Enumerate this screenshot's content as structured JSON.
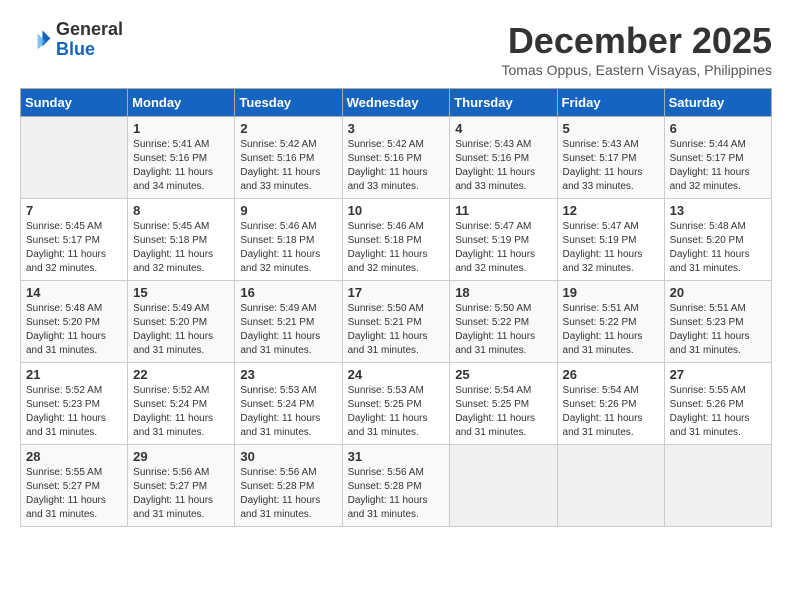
{
  "header": {
    "logo_line1": "General",
    "logo_line2": "Blue",
    "month_year": "December 2025",
    "location": "Tomas Oppus, Eastern Visayas, Philippines"
  },
  "calendar": {
    "days_of_week": [
      "Sunday",
      "Monday",
      "Tuesday",
      "Wednesday",
      "Thursday",
      "Friday",
      "Saturday"
    ],
    "weeks": [
      [
        {
          "day": "",
          "sunrise": "",
          "sunset": "",
          "daylight": ""
        },
        {
          "day": "1",
          "sunrise": "Sunrise: 5:41 AM",
          "sunset": "Sunset: 5:16 PM",
          "daylight": "Daylight: 11 hours and 34 minutes."
        },
        {
          "day": "2",
          "sunrise": "Sunrise: 5:42 AM",
          "sunset": "Sunset: 5:16 PM",
          "daylight": "Daylight: 11 hours and 33 minutes."
        },
        {
          "day": "3",
          "sunrise": "Sunrise: 5:42 AM",
          "sunset": "Sunset: 5:16 PM",
          "daylight": "Daylight: 11 hours and 33 minutes."
        },
        {
          "day": "4",
          "sunrise": "Sunrise: 5:43 AM",
          "sunset": "Sunset: 5:16 PM",
          "daylight": "Daylight: 11 hours and 33 minutes."
        },
        {
          "day": "5",
          "sunrise": "Sunrise: 5:43 AM",
          "sunset": "Sunset: 5:17 PM",
          "daylight": "Daylight: 11 hours and 33 minutes."
        },
        {
          "day": "6",
          "sunrise": "Sunrise: 5:44 AM",
          "sunset": "Sunset: 5:17 PM",
          "daylight": "Daylight: 11 hours and 32 minutes."
        }
      ],
      [
        {
          "day": "7",
          "sunrise": "Sunrise: 5:45 AM",
          "sunset": "Sunset: 5:17 PM",
          "daylight": "Daylight: 11 hours and 32 minutes."
        },
        {
          "day": "8",
          "sunrise": "Sunrise: 5:45 AM",
          "sunset": "Sunset: 5:18 PM",
          "daylight": "Daylight: 11 hours and 32 minutes."
        },
        {
          "day": "9",
          "sunrise": "Sunrise: 5:46 AM",
          "sunset": "Sunset: 5:18 PM",
          "daylight": "Daylight: 11 hours and 32 minutes."
        },
        {
          "day": "10",
          "sunrise": "Sunrise: 5:46 AM",
          "sunset": "Sunset: 5:18 PM",
          "daylight": "Daylight: 11 hours and 32 minutes."
        },
        {
          "day": "11",
          "sunrise": "Sunrise: 5:47 AM",
          "sunset": "Sunset: 5:19 PM",
          "daylight": "Daylight: 11 hours and 32 minutes."
        },
        {
          "day": "12",
          "sunrise": "Sunrise: 5:47 AM",
          "sunset": "Sunset: 5:19 PM",
          "daylight": "Daylight: 11 hours and 32 minutes."
        },
        {
          "day": "13",
          "sunrise": "Sunrise: 5:48 AM",
          "sunset": "Sunset: 5:20 PM",
          "daylight": "Daylight: 11 hours and 31 minutes."
        }
      ],
      [
        {
          "day": "14",
          "sunrise": "Sunrise: 5:48 AM",
          "sunset": "Sunset: 5:20 PM",
          "daylight": "Daylight: 11 hours and 31 minutes."
        },
        {
          "day": "15",
          "sunrise": "Sunrise: 5:49 AM",
          "sunset": "Sunset: 5:20 PM",
          "daylight": "Daylight: 11 hours and 31 minutes."
        },
        {
          "day": "16",
          "sunrise": "Sunrise: 5:49 AM",
          "sunset": "Sunset: 5:21 PM",
          "daylight": "Daylight: 11 hours and 31 minutes."
        },
        {
          "day": "17",
          "sunrise": "Sunrise: 5:50 AM",
          "sunset": "Sunset: 5:21 PM",
          "daylight": "Daylight: 11 hours and 31 minutes."
        },
        {
          "day": "18",
          "sunrise": "Sunrise: 5:50 AM",
          "sunset": "Sunset: 5:22 PM",
          "daylight": "Daylight: 11 hours and 31 minutes."
        },
        {
          "day": "19",
          "sunrise": "Sunrise: 5:51 AM",
          "sunset": "Sunset: 5:22 PM",
          "daylight": "Daylight: 11 hours and 31 minutes."
        },
        {
          "day": "20",
          "sunrise": "Sunrise: 5:51 AM",
          "sunset": "Sunset: 5:23 PM",
          "daylight": "Daylight: 11 hours and 31 minutes."
        }
      ],
      [
        {
          "day": "21",
          "sunrise": "Sunrise: 5:52 AM",
          "sunset": "Sunset: 5:23 PM",
          "daylight": "Daylight: 11 hours and 31 minutes."
        },
        {
          "day": "22",
          "sunrise": "Sunrise: 5:52 AM",
          "sunset": "Sunset: 5:24 PM",
          "daylight": "Daylight: 11 hours and 31 minutes."
        },
        {
          "day": "23",
          "sunrise": "Sunrise: 5:53 AM",
          "sunset": "Sunset: 5:24 PM",
          "daylight": "Daylight: 11 hours and 31 minutes."
        },
        {
          "day": "24",
          "sunrise": "Sunrise: 5:53 AM",
          "sunset": "Sunset: 5:25 PM",
          "daylight": "Daylight: 11 hours and 31 minutes."
        },
        {
          "day": "25",
          "sunrise": "Sunrise: 5:54 AM",
          "sunset": "Sunset: 5:25 PM",
          "daylight": "Daylight: 11 hours and 31 minutes."
        },
        {
          "day": "26",
          "sunrise": "Sunrise: 5:54 AM",
          "sunset": "Sunset: 5:26 PM",
          "daylight": "Daylight: 11 hours and 31 minutes."
        },
        {
          "day": "27",
          "sunrise": "Sunrise: 5:55 AM",
          "sunset": "Sunset: 5:26 PM",
          "daylight": "Daylight: 11 hours and 31 minutes."
        }
      ],
      [
        {
          "day": "28",
          "sunrise": "Sunrise: 5:55 AM",
          "sunset": "Sunset: 5:27 PM",
          "daylight": "Daylight: 11 hours and 31 minutes."
        },
        {
          "day": "29",
          "sunrise": "Sunrise: 5:56 AM",
          "sunset": "Sunset: 5:27 PM",
          "daylight": "Daylight: 11 hours and 31 minutes."
        },
        {
          "day": "30",
          "sunrise": "Sunrise: 5:56 AM",
          "sunset": "Sunset: 5:28 PM",
          "daylight": "Daylight: 11 hours and 31 minutes."
        },
        {
          "day": "31",
          "sunrise": "Sunrise: 5:56 AM",
          "sunset": "Sunset: 5:28 PM",
          "daylight": "Daylight: 11 hours and 31 minutes."
        },
        {
          "day": "",
          "sunrise": "",
          "sunset": "",
          "daylight": ""
        },
        {
          "day": "",
          "sunrise": "",
          "sunset": "",
          "daylight": ""
        },
        {
          "day": "",
          "sunrise": "",
          "sunset": "",
          "daylight": ""
        }
      ]
    ]
  }
}
